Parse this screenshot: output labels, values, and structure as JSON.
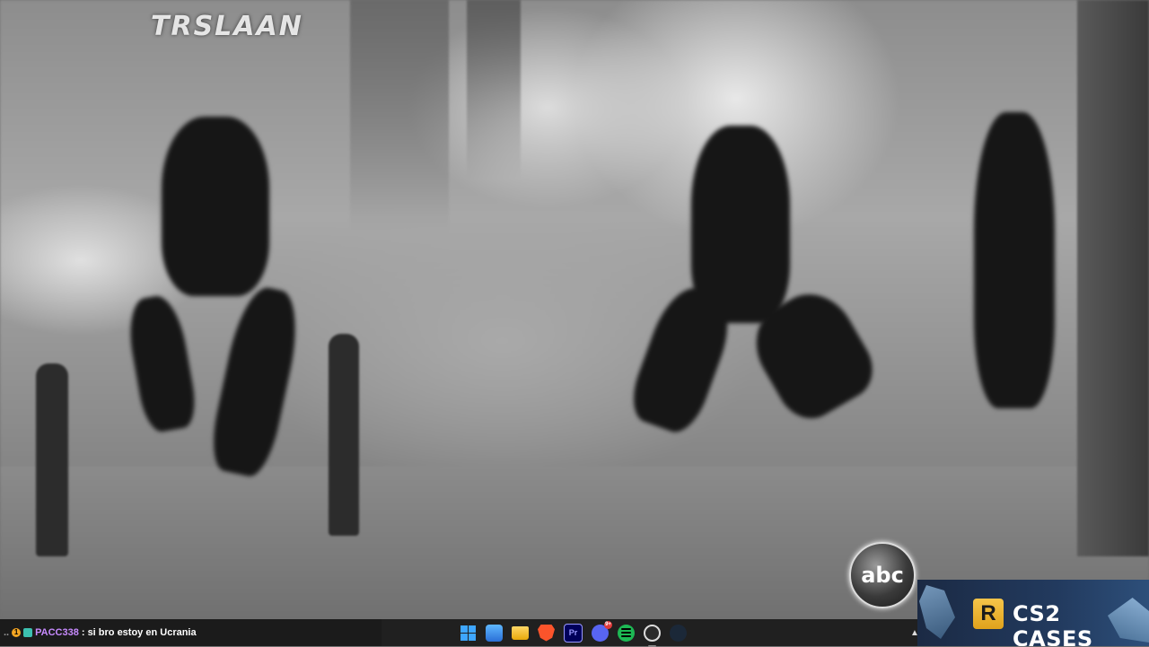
{
  "video": {
    "top_watermark": "TRSLAAN",
    "network_logo": "abc"
  },
  "ad": {
    "badge": "R",
    "title": "CS2 CASES"
  },
  "chat": {
    "prefix": "..",
    "badge_count": "1",
    "username": "PACC338",
    "message": ": si bro estoy en Ucrania"
  },
  "taskbar": {
    "apps": [
      {
        "name": "start",
        "icon": "windows-logo-icon"
      },
      {
        "name": "photos",
        "icon": "photos-icon"
      },
      {
        "name": "file-explorer",
        "icon": "folder-icon"
      },
      {
        "name": "brave",
        "icon": "brave-lion-icon"
      },
      {
        "name": "premiere",
        "icon": "premiere-pro-icon",
        "label": "Pr"
      },
      {
        "name": "discord",
        "icon": "discord-icon",
        "notification": "9+"
      },
      {
        "name": "spotify",
        "icon": "spotify-icon"
      },
      {
        "name": "obs",
        "icon": "obs-icon"
      },
      {
        "name": "steam",
        "icon": "steam-icon"
      }
    ],
    "overflow_icon": "chevron-up-icon"
  },
  "colors": {
    "taskbar_bg": "#202020",
    "chat_username": "#c88bff",
    "ad_badge": "#f5b730",
    "ad_bg": "#1b2a44"
  }
}
